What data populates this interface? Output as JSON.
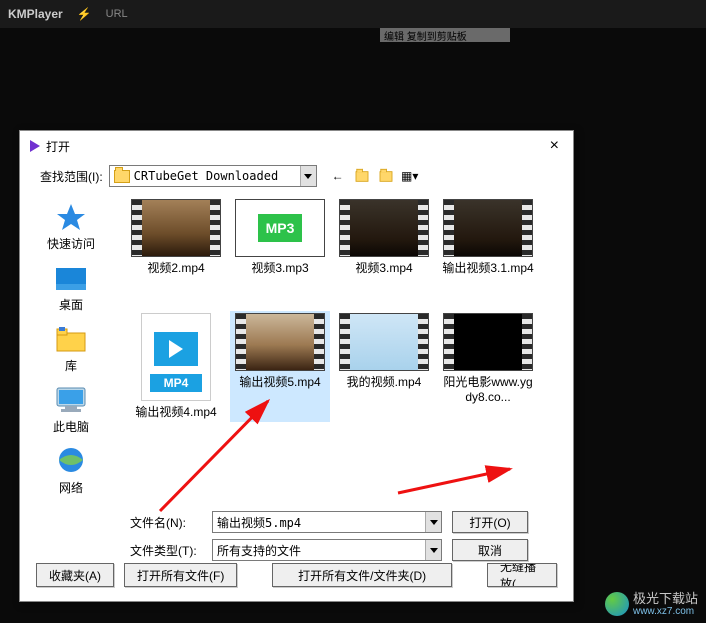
{
  "titlebar": {
    "app": "KMPlayer",
    "url_label": "URL"
  },
  "topstrip": "编辑 复制到剪贴板",
  "dialog": {
    "title": "打开",
    "lookin_label": "查找范围(I):",
    "folder_name": "CRTubeGet Downloaded",
    "places": {
      "quick": "快速访问",
      "desktop": "桌面",
      "library": "库",
      "thispc": "此电脑",
      "network": "网络"
    },
    "files": [
      {
        "label": "视频2.mp4",
        "type": "video",
        "thumb": "sun-thumb"
      },
      {
        "label": "视频3.mp3",
        "type": "mp3"
      },
      {
        "label": "视频3.mp4",
        "type": "video",
        "thumb": "dark-low"
      },
      {
        "label": "输出视频3.1.mp4",
        "type": "video",
        "thumb": "dark-low"
      },
      {
        "label": "输出视频4.mp4",
        "type": "mp4file"
      },
      {
        "label": "输出视频5.mp4",
        "type": "video",
        "thumb": "clouds",
        "selected": true
      },
      {
        "label": "我的视频.mp4",
        "type": "video",
        "thumb": "surf"
      },
      {
        "label": "阳光电影www.ygdy8.co...",
        "type": "video",
        "thumb": "black"
      }
    ],
    "filename_label": "文件名(N):",
    "filename_value": "输出视频5.mp4",
    "filetype_label": "文件类型(T):",
    "filetype_value": "所有支持的文件",
    "open_btn": "打开(O)",
    "cancel_btn": "取消",
    "bottom": {
      "fav": "收藏夹(A)",
      "open_all_files": "打开所有文件(F)",
      "open_all_folders": "打开所有文件/文件夹(D)",
      "seamless": "无缝播放("
    }
  },
  "watermark": {
    "name": "极光下载站",
    "url": "www.xz7.com"
  }
}
